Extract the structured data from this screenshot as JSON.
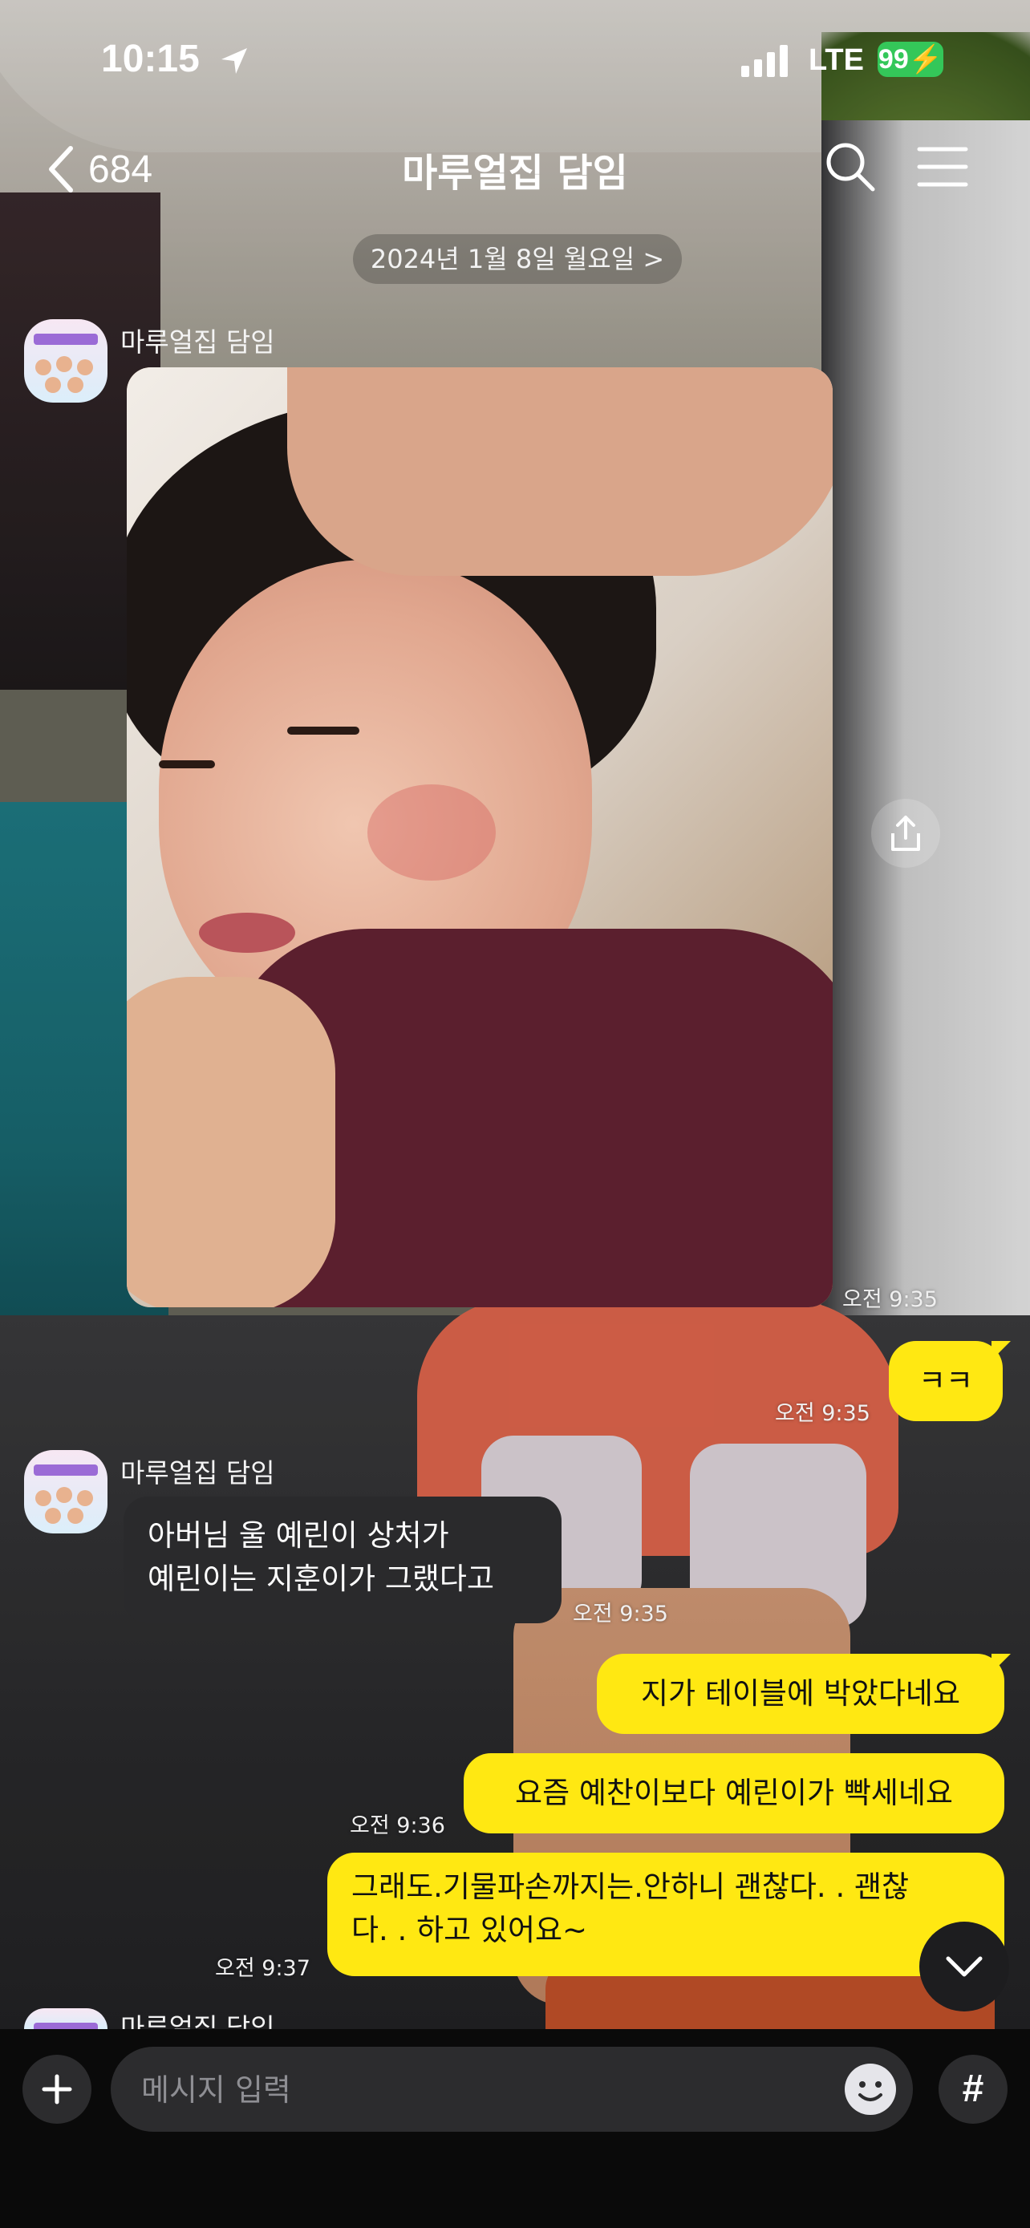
{
  "status_bar": {
    "time": "10:15",
    "network": "LTE",
    "battery": "99"
  },
  "header": {
    "back_count": "684",
    "title": "마루얼집 담임"
  },
  "date_separator": "2024년 1월 8일 월요일 >",
  "messages": [
    {
      "sender": "마루얼집 담임",
      "type": "photo",
      "time": "오전 9:35"
    },
    {
      "sender": "me",
      "type": "text",
      "text": "ㅋㅋ",
      "time": "오전 9:35"
    },
    {
      "sender": "마루얼집 담임",
      "type": "text",
      "lines": [
        "아버님 울 예린이 상처가",
        "예린이는 지훈이가 그랬다고"
      ],
      "time": "오전 9:35"
    },
    {
      "sender": "me",
      "type": "text",
      "text": "지가 테이블에 박았다네요"
    },
    {
      "sender": "me",
      "type": "text",
      "text": "요즘 예찬이보다 예린이가 빡세네요",
      "time": "오전 9:36"
    },
    {
      "sender": "me",
      "type": "text",
      "lines": [
        "그래도.기물파손까지는.안하니 괜찮다. . 괜찮",
        "다. . 하고 있어요~"
      ],
      "time": "오전 9:37"
    },
    {
      "sender": "마루얼집 담임",
      "type": "partial"
    }
  ],
  "input": {
    "placeholder": "메시지 입력",
    "hash_label": "#"
  },
  "colors": {
    "outgoing_bubble": "#ffe812",
    "incoming_bubble": "#2a2a2c",
    "battery": "#34c759"
  },
  "icons": [
    "location-arrow-icon",
    "signal-bars-icon",
    "back-chevron-icon",
    "search-icon",
    "menu-icon",
    "share-icon",
    "chevron-down-icon",
    "plus-icon",
    "emoji-icon"
  ]
}
